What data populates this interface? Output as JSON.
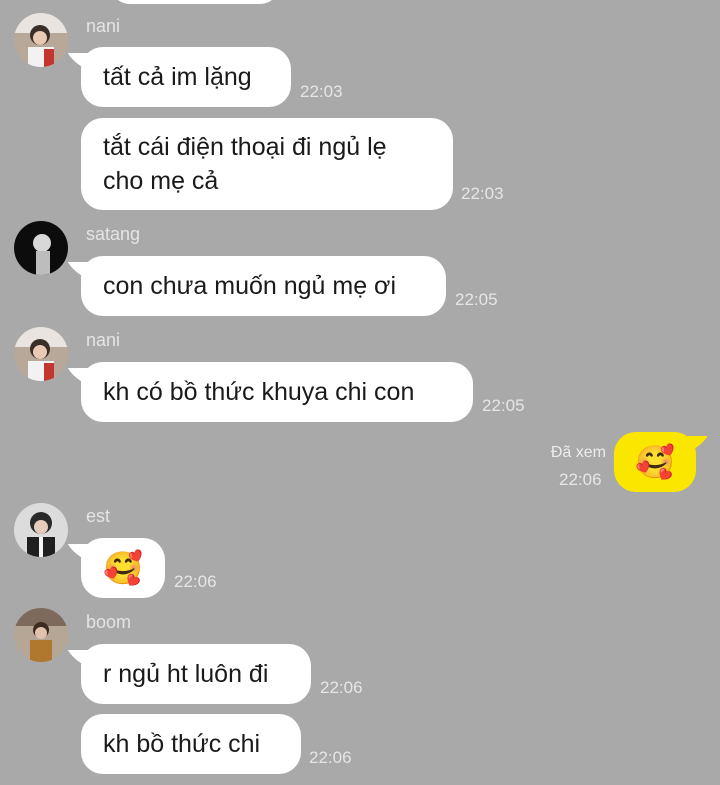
{
  "messages": [
    {
      "sender": "nani",
      "text": "tất cả im lặng",
      "time": "22:03"
    },
    {
      "text": "tắt cái điện thoại đi ngủ lẹ cho mẹ cả",
      "time": "22:03"
    },
    {
      "sender": "satang",
      "text": "con chưa muốn ngủ mẹ ơi",
      "time": "22:05"
    },
    {
      "sender": "nani",
      "text": "kh có bồ thức khuya chi con",
      "time": "22:05"
    },
    {
      "read_label": "Đã xem",
      "time": "22:06",
      "emoji": "🥰"
    },
    {
      "sender": "est",
      "emoji": "🥰",
      "time": "22:06"
    },
    {
      "sender": "boom",
      "text": "r ngủ ht luôn đi",
      "time": "22:06"
    },
    {
      "text": "kh bồ thức chi",
      "time": "22:06"
    }
  ],
  "colors": {
    "background": "#a9a9a9",
    "bubble_incoming": "#ffffff",
    "bubble_outgoing": "#fbe600"
  }
}
